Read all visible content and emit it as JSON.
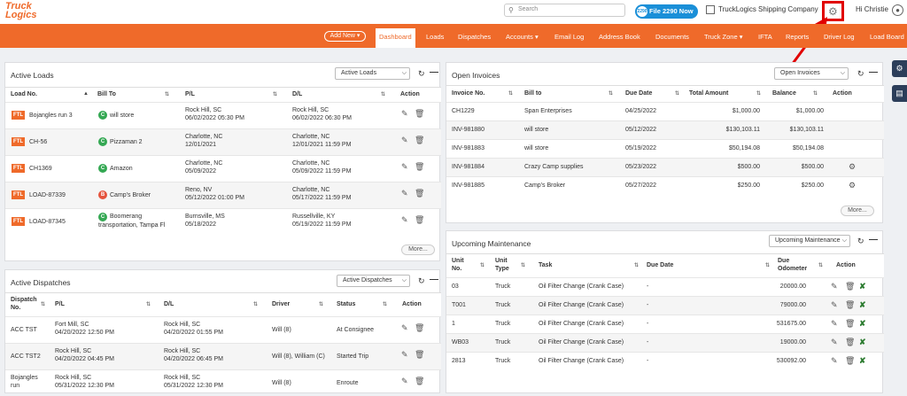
{
  "topbar": {
    "logo_line1": "Truck",
    "logo_line2": "Logics",
    "search_placeholder": "Search",
    "file2290_label": "File 2290 Now",
    "file2290_badge": "2290",
    "company_name": "TruckLogics Shipping Company",
    "greeting": "Hi Christie"
  },
  "nav": {
    "add_new": "Add New",
    "items": [
      "Dashboard",
      "Loads",
      "Dispatches",
      "Accounts",
      "Email Log",
      "Address Book",
      "Documents",
      "Truck Zone",
      "IFTA",
      "Reports",
      "Driver Log",
      "Load Board"
    ]
  },
  "active_loads": {
    "title": "Active Loads",
    "select": "Active Loads",
    "headers": [
      "Load No.",
      "Bill To",
      "P/L",
      "D/L",
      "Action"
    ],
    "rows": [
      {
        "badge": "FTL",
        "load": "Bojangles run 3",
        "bill_badge": "C",
        "bill_color": "#34a853",
        "bill": "will store",
        "pl1": "Rock Hill, SC",
        "pl2": "06/02/2022 05:30 PM",
        "dl1": "Rock Hill, SC",
        "dl2": "06/02/2022 06:30 PM"
      },
      {
        "badge": "FTL",
        "load": "CH-56",
        "bill_badge": "C",
        "bill_color": "#34a853",
        "bill": "Pizzaman 2",
        "pl1": "Charlotte, NC",
        "pl2": "12/01/2021",
        "dl1": "Charlotte, NC",
        "dl2": "12/01/2021 11:59 PM"
      },
      {
        "badge": "FTL",
        "load": "CH1369",
        "bill_badge": "C",
        "bill_color": "#34a853",
        "bill": "Amazon",
        "pl1": "Charlotte, NC",
        "pl2": "05/09/2022",
        "dl1": "Charlotte, NC",
        "dl2": "05/09/2022 11:59 PM"
      },
      {
        "badge": "FTL",
        "load": "LOAD-87339",
        "bill_badge": "B",
        "bill_color": "#e5533d",
        "bill": "Camp's Broker",
        "pl1": "Reno, NV",
        "pl2": "05/12/2022 01:00 PM",
        "dl1": "Charlotte, NC",
        "dl2": "05/17/2022 11:59 PM"
      },
      {
        "badge": "FTL",
        "load": "LOAD-87345",
        "bill_badge": "C",
        "bill_color": "#34a853",
        "bill": "Boomerang",
        "bill2": "transportation, Tampa Fl",
        "pl1": "Burnsville, MS",
        "pl2": "05/18/2022",
        "dl1": "Russellville, KY",
        "dl2": "05/19/2022 11:59 PM"
      }
    ],
    "more": "More..."
  },
  "active_dispatches": {
    "title": "Active Dispatches",
    "select": "Active Dispatches",
    "headers": [
      "Dispatch",
      "No.",
      "P/L",
      "D/L",
      "Driver",
      "Status",
      "Action"
    ],
    "rows": [
      {
        "no": "ACC TST",
        "no2": "",
        "pl1": "Fort Mill, SC",
        "pl2": "04/20/2022 12:50 PM",
        "dl1": "Rock Hill, SC",
        "dl2": "04/20/2022 01:55 PM",
        "driver": "Will (8)",
        "status": "At Consignee"
      },
      {
        "no": "ACC TST2",
        "no2": "",
        "pl1": "Rock Hill, SC",
        "pl2": "04/20/2022 04:45 PM",
        "dl1": "Rock Hill, SC",
        "dl2": "04/20/2022 06:45 PM",
        "driver": "Will (8), William (C)",
        "status": "Started Trip"
      },
      {
        "no": "Bojangles",
        "no2": "run",
        "pl1": "Rock Hill, SC",
        "pl2": "05/31/2022 12:30 PM",
        "dl1": "Rock Hill, SC",
        "dl2": "05/31/2022 12:30 PM",
        "driver": "Will (8)",
        "status": "Enroute"
      }
    ]
  },
  "open_invoices": {
    "title": "Open Invoices",
    "select": "Open Invoices",
    "headers": [
      "Invoice No.",
      "Bill to",
      "Due Date",
      "Total Amount",
      "Balance",
      "Action"
    ],
    "rows": [
      {
        "no": "CH1229",
        "bill": "Span Enterprises",
        "due": "04/25/2022",
        "total": "$1,000.00",
        "balance": "$1,000.00",
        "act": false
      },
      {
        "no": "INV-981880",
        "bill": "will store",
        "due": "05/12/2022",
        "total": "$130,103.11",
        "balance": "$130,103.11",
        "act": false
      },
      {
        "no": "INV-981883",
        "bill": "will store",
        "due": "05/19/2022",
        "total": "$50,194.08",
        "balance": "$50,194.08",
        "act": false
      },
      {
        "no": "INV-981884",
        "bill": "Crazy Camp supplies",
        "due": "05/23/2022",
        "total": "$500.00",
        "balance": "$500.00",
        "act": true
      },
      {
        "no": "INV-981885",
        "bill": "Camp's Broker",
        "due": "05/27/2022",
        "total": "$250.00",
        "balance": "$250.00",
        "act": true
      }
    ],
    "more": "More..."
  },
  "upcoming_maintenance": {
    "title": "Upcoming Maintenance",
    "select": "Upcoming Maintenance",
    "headers": [
      "Unit",
      "No.",
      "Unit",
      "Type",
      "Task",
      "Due Date",
      "Due",
      "Odometer",
      "Action"
    ],
    "rows": [
      {
        "unit": "03",
        "type": "Truck",
        "task": "Oil Filter Change (Crank Case)",
        "due": "-",
        "odo": "20000.00"
      },
      {
        "unit": "T001",
        "type": "Truck",
        "task": "Oil Filter Change (Crank Case)",
        "due": "-",
        "odo": "79000.00"
      },
      {
        "unit": "1",
        "type": "Truck",
        "task": "Oil Filter Change (Crank Case)",
        "due": "-",
        "odo": "531675.00"
      },
      {
        "unit": "WB03",
        "type": "Truck",
        "task": "Oil Filter Change (Crank Case)",
        "due": "-",
        "odo": "19000.00"
      },
      {
        "unit": "2813",
        "type": "Truck",
        "task": "Oil Filter Change (Crank Case)",
        "due": "-",
        "odo": "530092.00"
      }
    ]
  },
  "colors": {
    "brand": "#ef6a2a",
    "highlight": "#e10000",
    "file2290": "#1a8fd8"
  }
}
